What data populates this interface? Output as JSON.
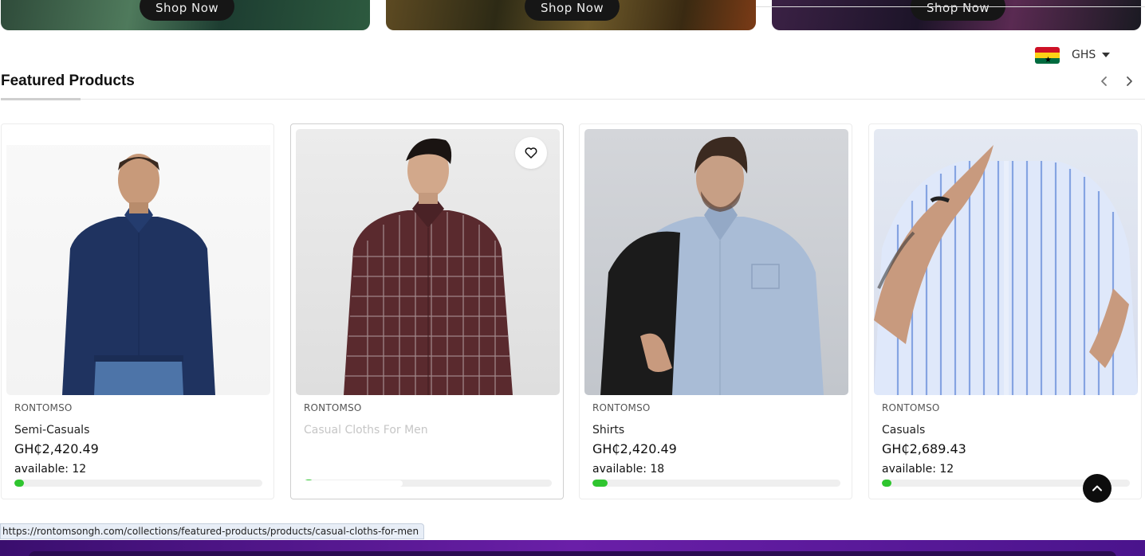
{
  "banners": [
    {
      "button_label": "Shop Now"
    },
    {
      "button_label": "Shop Now"
    },
    {
      "button_label": "Shop Now"
    }
  ],
  "currency": {
    "code": "GHS",
    "flag_icon": "ghana-flag-icon"
  },
  "section": {
    "title": "Featured Products"
  },
  "products": [
    {
      "vendor": "RONTOMSO",
      "name": "Semi-Casuals",
      "price": "GH₵2,420.49",
      "availability": "available: 12",
      "stock_fraction": 0.04
    },
    {
      "vendor": "RONTOMSO",
      "name": "Casual Cloths For Men",
      "price": "",
      "availability": "",
      "stock_fraction": 0.04
    },
    {
      "vendor": "RONTOMSO",
      "name": "Shirts",
      "price": "GH₵2,420.49",
      "availability": "available: 18",
      "stock_fraction": 0.06
    },
    {
      "vendor": "RONTOMSO",
      "name": "Casuals",
      "price": "GH₵2,689.43",
      "availability": "available: 12",
      "stock_fraction": 0.04
    }
  ],
  "status_bar": {
    "url": "https://rontomsongh.com/collections/featured-products/products/casual-cloths-for-men"
  },
  "colors": {
    "stock_bar": "#2fc52f",
    "dark_button": "#0d0d0d"
  }
}
